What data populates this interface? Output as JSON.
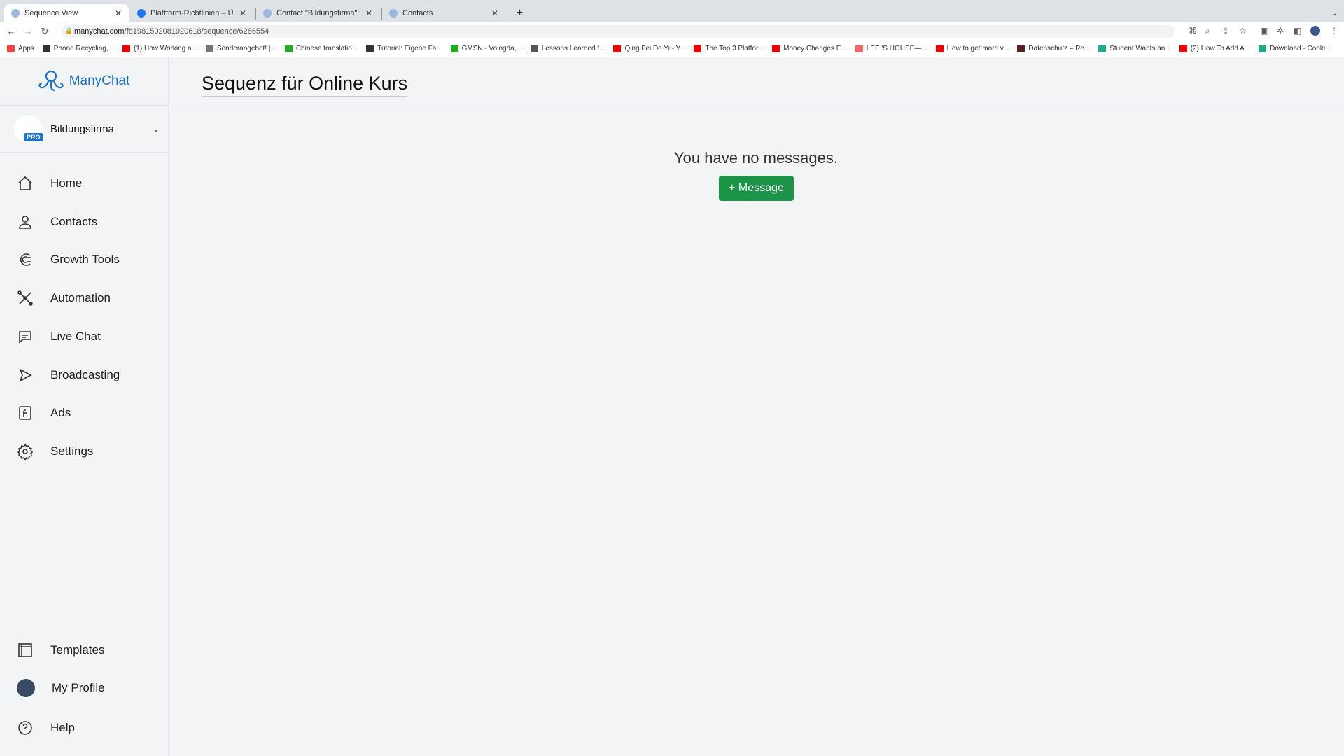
{
  "browser": {
    "tabs": [
      {
        "title": "Sequence View",
        "active": true
      },
      {
        "title": "Plattform-Richtlinien – Übersicht"
      },
      {
        "title": "Contact \"Bildungsfirma\" through"
      },
      {
        "title": "Contacts"
      }
    ],
    "url_host": "manychat.com",
    "url_path": "/fb1981502081920618/sequence/6286554",
    "bookmarks": [
      "Apps",
      "Phone Recycling,...",
      "(1) How Working a...",
      "Sonderangebot! |...",
      "Chinese translatio...",
      "Tutorial: Eigene Fa...",
      "GMSN - Vologda,...",
      "Lessons Learned f...",
      "Qing Fei De Yi - Y...",
      "The Top 3 Platfor...",
      "Money Changes E...",
      "LEE 'S HOUSE—...",
      "How to get more v...",
      "Datenschutz – Re...",
      "Student Wants an...",
      "(2) How To Add A...",
      "Download - Cooki..."
    ]
  },
  "sidebar": {
    "brand": "ManyChat",
    "account": {
      "name": "Bildungsfirma",
      "badge": "PRO"
    },
    "items": [
      {
        "label": "Home",
        "icon": "home-icon"
      },
      {
        "label": "Contacts",
        "icon": "user-icon"
      },
      {
        "label": "Growth Tools",
        "icon": "magnet-icon"
      },
      {
        "label": "Automation",
        "icon": "automation-icon"
      },
      {
        "label": "Live Chat",
        "icon": "chat-icon"
      },
      {
        "label": "Broadcasting",
        "icon": "send-icon"
      },
      {
        "label": "Ads",
        "icon": "ads-icon"
      },
      {
        "label": "Settings",
        "icon": "gear-icon"
      }
    ],
    "bottom": [
      {
        "label": "Templates",
        "icon": "templates-icon"
      },
      {
        "label": "My Profile",
        "icon": "avatar"
      },
      {
        "label": "Help",
        "icon": "help-icon"
      }
    ]
  },
  "main": {
    "title": "Sequenz für Online Kurs",
    "empty_text": "You have no messages.",
    "add_button": "+ Message"
  },
  "colors": {
    "brand": "#1a73c8",
    "button": "#1c9447"
  }
}
